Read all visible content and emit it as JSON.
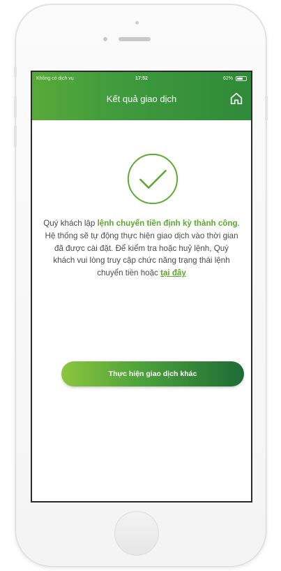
{
  "status_bar": {
    "carrier": "Không có dịch vụ",
    "time": "17:52",
    "battery": "62%"
  },
  "header": {
    "title": "Kết quả giao dịch",
    "home_icon": "home-icon"
  },
  "result": {
    "icon": "check-circle-icon",
    "message_part1": "Quý khách lập ",
    "message_highlight": "lệnh chuyển tiền định kỳ thành công",
    "message_part2": ". Hệ thống sẽ tự động thực hiện giao dịch vào thời gian đã được cài đặt. Để kiểm tra hoặc huỷ lệnh, Quý khách vui lòng truy cập chức năng trạng thái lệnh chuyển tiền hoặc ",
    "link_text": "tại đây"
  },
  "actions": {
    "primary_label": "Thực hiện giao dịch khác"
  },
  "colors": {
    "brand_green": "#4aa03a",
    "accent_green": "#5da82f",
    "dark_green": "#1f6b36"
  }
}
